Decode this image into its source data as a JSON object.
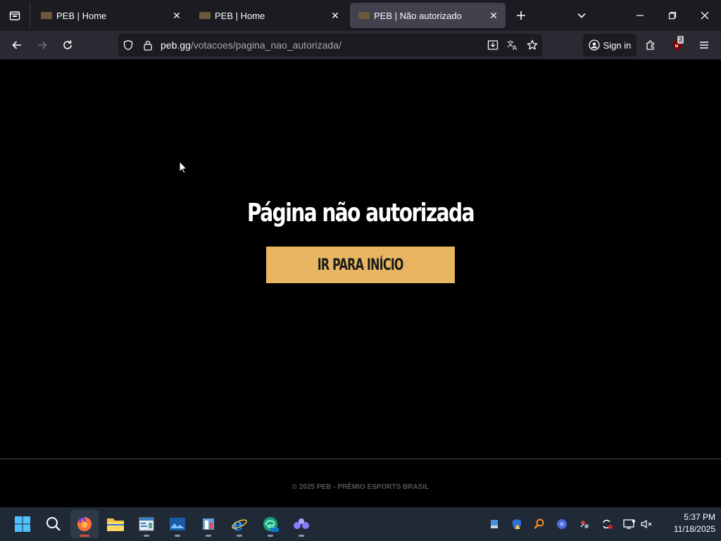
{
  "browser": {
    "tabs": [
      {
        "title": "PEB | Home",
        "active": false
      },
      {
        "title": "PEB | Home",
        "active": false
      },
      {
        "title": "PEB | Não autorizado",
        "active": true
      }
    ],
    "url_host": "peb.gg",
    "url_path": "/votacoes/pagina_nao_autorizada/",
    "signin_label": "Sign in",
    "extension_badge": "3"
  },
  "page": {
    "title": "Página não autorizada",
    "home_button": "IR PARA INÍCIO",
    "footer": "© 2025 PEB - PRÊMIO ESPORTS BRASIL",
    "accent_color": "#e8b563"
  },
  "taskbar": {
    "time": "5:37 PM",
    "date": "11/18/2025"
  }
}
